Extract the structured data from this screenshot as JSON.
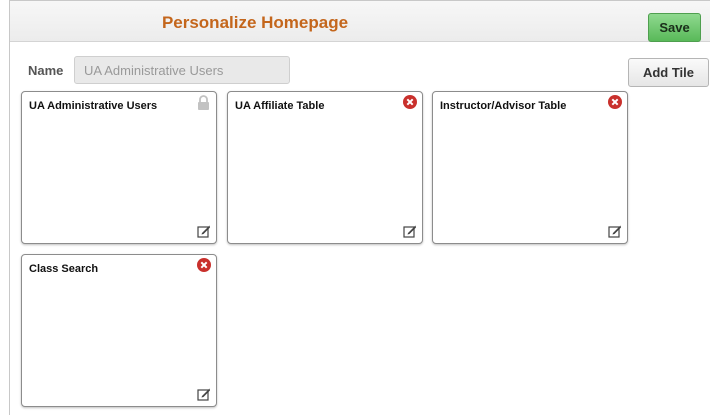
{
  "header": {
    "title": "Personalize Homepage",
    "save_label": "Save"
  },
  "form": {
    "name_label": "Name",
    "name_value": "UA Administrative Users",
    "add_tile_label": "Add Tile"
  },
  "tiles": [
    {
      "title": "UA Administrative Users",
      "status_icon": "lock-icon",
      "removable": false
    },
    {
      "title": "UA Affiliate Table",
      "status_icon": "remove-icon",
      "removable": true
    },
    {
      "title": "Instructor/Advisor Table",
      "status_icon": "remove-icon",
      "removable": true
    },
    {
      "title": "Class Search",
      "status_icon": "remove-icon",
      "removable": true
    }
  ],
  "colors": {
    "title": "#c4661c",
    "save": "#59b959",
    "remove": "#c9302c"
  }
}
